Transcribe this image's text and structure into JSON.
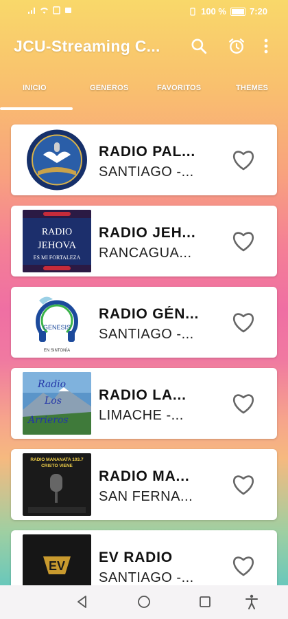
{
  "status_bar": {
    "battery_percent": "100 %",
    "time": "7:20"
  },
  "app_bar": {
    "title": "JCU-Streaming C...",
    "icons": [
      "search-icon",
      "alarm-clock-icon",
      "more-vert-icon"
    ]
  },
  "tabs": [
    {
      "label": "INICIO",
      "selected": true
    },
    {
      "label": "GENEROS",
      "selected": false
    },
    {
      "label": "FAVORITOS",
      "selected": false
    },
    {
      "label": "THEMES",
      "selected": false
    }
  ],
  "stations": [
    {
      "name": "RADIO PAL...",
      "city": "SANTIAGO -..."
    },
    {
      "name": "RADIO JEH...",
      "city": "RANCAGUA..."
    },
    {
      "name": "RADIO GÉN...",
      "city": "SANTIAGO -..."
    },
    {
      "name": "RADIO LA...",
      "city": "LIMACHE -..."
    },
    {
      "name": "RADIO MA...",
      "city": "SAN FERNA..."
    },
    {
      "name": "EV RADIO",
      "city": "SANTIAGO -..."
    }
  ],
  "logo_text": {
    "station_2": [
      "RADIO",
      "JEHOVA",
      "ES MI FORTALEZA"
    ],
    "station_3": [
      "GENESIS",
      "EN SINTONÍA"
    ],
    "station_4": [
      "Radio",
      "Los",
      "Arrieros"
    ],
    "station_5": [
      "RADIO MANANATA 103.7",
      "CRISTO VIENE"
    ],
    "station_6": [
      "EV"
    ]
  },
  "nav_bar": {
    "buttons": [
      "back-icon",
      "home-icon",
      "recents-icon",
      "accessibility-icon"
    ]
  },
  "colors": {
    "gradient_top": "#f9d86a",
    "gradient_mid": "#ef6fa3",
    "gradient_bottom": "#48c3cb",
    "card_bg": "#ffffff",
    "heart_stroke": "#666666"
  }
}
